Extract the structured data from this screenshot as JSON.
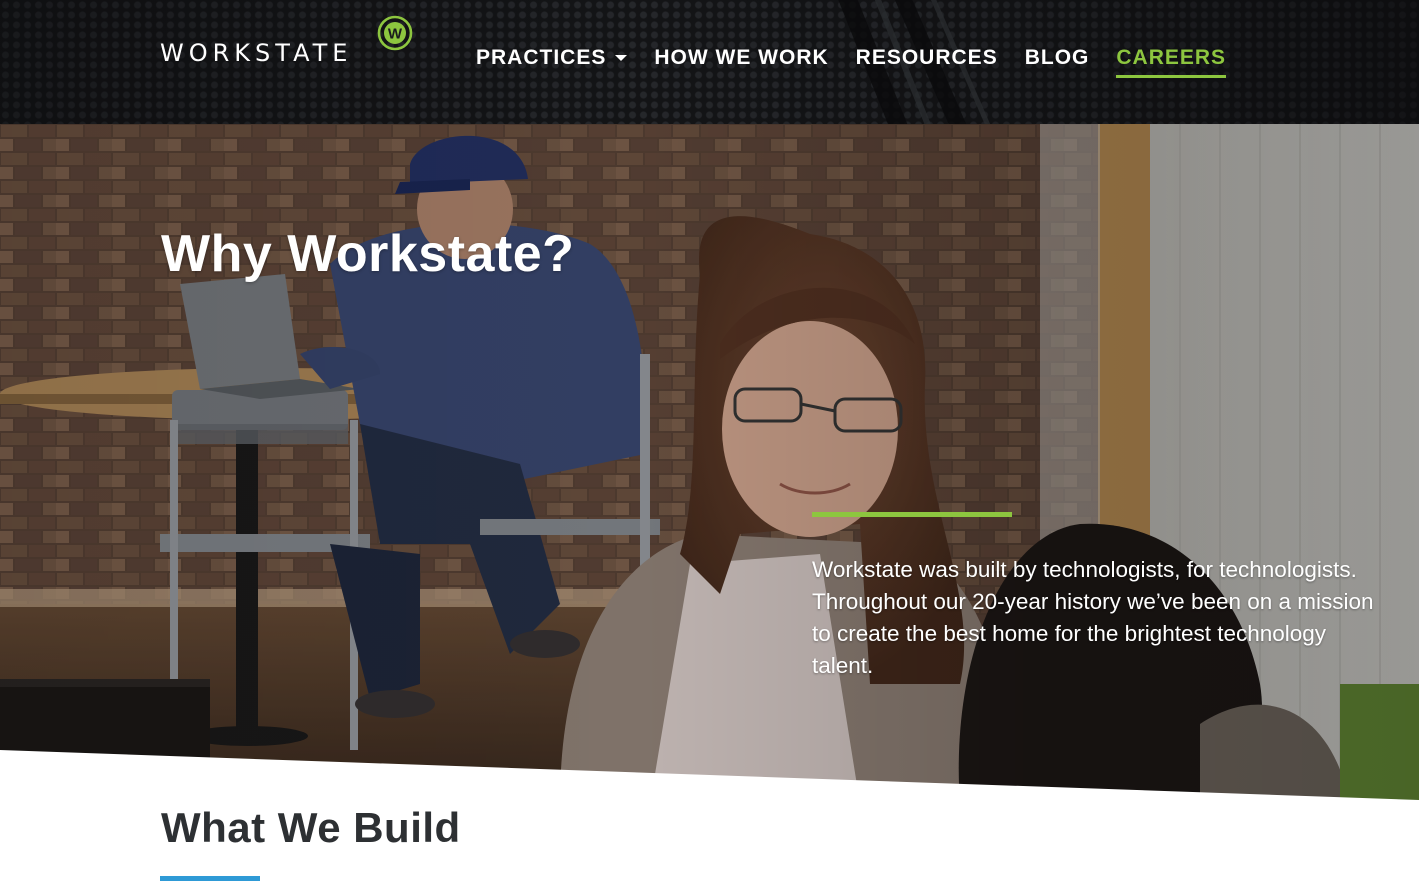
{
  "brand": {
    "name": "WORKSTATE",
    "mark_letter": "W",
    "accent_color": "#8dc63f",
    "secondary_color": "#2e9ad6"
  },
  "nav": {
    "items": [
      {
        "label": "PRACTICES",
        "has_dropdown": true,
        "active": false
      },
      {
        "label": "HOW WE WORK",
        "has_dropdown": false,
        "active": false
      },
      {
        "label": "RESOURCES",
        "has_dropdown": false,
        "active": false
      },
      {
        "label": "BLOG",
        "has_dropdown": false,
        "active": false
      },
      {
        "label": "CAREERS",
        "has_dropdown": false,
        "active": true
      }
    ]
  },
  "hero": {
    "title": "Why Workstate?",
    "body": "Workstate was built by technologists, for technologists. Throughout our 20-year history we’ve been on a mission to create the best home for the brightest technology talent."
  },
  "section": {
    "title": "What We Build"
  }
}
